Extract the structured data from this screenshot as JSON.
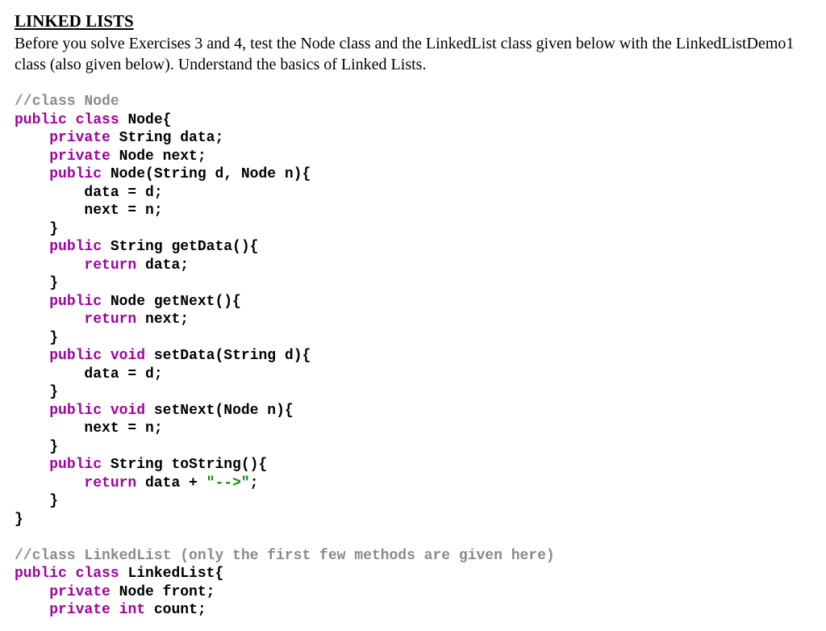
{
  "heading": "LINKED LISTS",
  "intro": "Before you solve Exercises 3 and 4, test the Node class and the LinkedList class given below with the LinkedListDemo1 class (also given below). Understand the basics of Linked Lists.",
  "code": [
    [
      {
        "cls": "comment",
        "t": "//class Node"
      }
    ],
    [
      {
        "cls": "keyword",
        "t": "public"
      },
      {
        "cls": "plain",
        "t": " "
      },
      {
        "cls": "classkw",
        "t": "class"
      },
      {
        "cls": "plain",
        "t": " Node{"
      }
    ],
    [
      {
        "cls": "plain",
        "t": "    "
      },
      {
        "cls": "keyword",
        "t": "private"
      },
      {
        "cls": "plain",
        "t": " String data;"
      }
    ],
    [
      {
        "cls": "plain",
        "t": "    "
      },
      {
        "cls": "keyword",
        "t": "private"
      },
      {
        "cls": "plain",
        "t": " Node next;"
      }
    ],
    [
      {
        "cls": "plain",
        "t": "    "
      },
      {
        "cls": "keyword",
        "t": "public"
      },
      {
        "cls": "plain",
        "t": " Node(String d, Node n){"
      }
    ],
    [
      {
        "cls": "plain",
        "t": "        data = d;"
      }
    ],
    [
      {
        "cls": "plain",
        "t": "        next = n;"
      }
    ],
    [
      {
        "cls": "plain",
        "t": "    }"
      }
    ],
    [
      {
        "cls": "plain",
        "t": "    "
      },
      {
        "cls": "keyword",
        "t": "public"
      },
      {
        "cls": "plain",
        "t": " String getData(){"
      }
    ],
    [
      {
        "cls": "plain",
        "t": "        "
      },
      {
        "cls": "rkeyword",
        "t": "return"
      },
      {
        "cls": "plain",
        "t": " data;"
      }
    ],
    [
      {
        "cls": "plain",
        "t": "    }"
      }
    ],
    [
      {
        "cls": "plain",
        "t": "    "
      },
      {
        "cls": "keyword",
        "t": "public"
      },
      {
        "cls": "plain",
        "t": " Node getNext(){"
      }
    ],
    [
      {
        "cls": "plain",
        "t": "        "
      },
      {
        "cls": "rkeyword",
        "t": "return"
      },
      {
        "cls": "plain",
        "t": " next;"
      }
    ],
    [
      {
        "cls": "plain",
        "t": "    }"
      }
    ],
    [
      {
        "cls": "plain",
        "t": "    "
      },
      {
        "cls": "keyword",
        "t": "public"
      },
      {
        "cls": "plain",
        "t": " "
      },
      {
        "cls": "keyword",
        "t": "void"
      },
      {
        "cls": "plain",
        "t": " setData(String d){"
      }
    ],
    [
      {
        "cls": "plain",
        "t": "        data = d;"
      }
    ],
    [
      {
        "cls": "plain",
        "t": "    }"
      }
    ],
    [
      {
        "cls": "plain",
        "t": "    "
      },
      {
        "cls": "keyword",
        "t": "public"
      },
      {
        "cls": "plain",
        "t": " "
      },
      {
        "cls": "keyword",
        "t": "void"
      },
      {
        "cls": "plain",
        "t": " setNext(Node n){"
      }
    ],
    [
      {
        "cls": "plain",
        "t": "        next = n;"
      }
    ],
    [
      {
        "cls": "plain",
        "t": "    }"
      }
    ],
    [
      {
        "cls": "plain",
        "t": "    "
      },
      {
        "cls": "keyword",
        "t": "public"
      },
      {
        "cls": "plain",
        "t": " String toString(){"
      }
    ],
    [
      {
        "cls": "plain",
        "t": "        "
      },
      {
        "cls": "rkeyword",
        "t": "return"
      },
      {
        "cls": "plain",
        "t": " data + "
      },
      {
        "cls": "string",
        "t": "\"-->\""
      },
      {
        "cls": "plain",
        "t": ";"
      }
    ],
    [
      {
        "cls": "plain",
        "t": "    }"
      }
    ],
    [
      {
        "cls": "plain",
        "t": "}"
      }
    ],
    [
      {
        "cls": "plain",
        "t": ""
      }
    ],
    [
      {
        "cls": "comment",
        "t": "//class LinkedList (only the first few methods are given here)"
      }
    ],
    [
      {
        "cls": "keyword",
        "t": "public"
      },
      {
        "cls": "plain",
        "t": " "
      },
      {
        "cls": "classkw",
        "t": "class"
      },
      {
        "cls": "plain",
        "t": " LinkedList{"
      }
    ],
    [
      {
        "cls": "plain",
        "t": "    "
      },
      {
        "cls": "keyword",
        "t": "private"
      },
      {
        "cls": "plain",
        "t": " Node front;"
      }
    ],
    [
      {
        "cls": "plain",
        "t": "    "
      },
      {
        "cls": "keyword",
        "t": "private"
      },
      {
        "cls": "plain",
        "t": " "
      },
      {
        "cls": "keyword",
        "t": "int"
      },
      {
        "cls": "plain",
        "t": " count;"
      }
    ]
  ]
}
